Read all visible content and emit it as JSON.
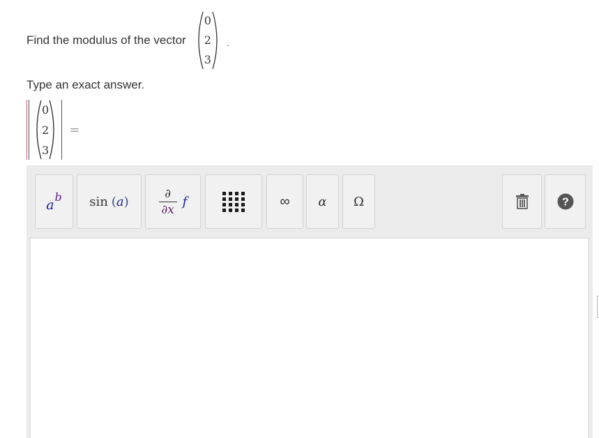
{
  "question": {
    "prefix": "Find the modulus of the vector",
    "vector": [
      "0",
      "2",
      "3"
    ],
    "suffix": "."
  },
  "instruction": "Type an exact answer.",
  "answer": {
    "vector": [
      "0",
      "2",
      "3"
    ],
    "equals": "="
  },
  "toolbar": {
    "power": {
      "base": "a",
      "exponent": "b"
    },
    "trig": {
      "func": "sin",
      "open": "(",
      "arg": "a",
      "close": ")"
    },
    "derivative": {
      "numerator": "∂",
      "denominator": "∂x",
      "func": "f"
    },
    "infinity": "∞",
    "greek": "α",
    "symbols": "Ω"
  },
  "colors": {
    "toolbar_bg": "#ebebeb",
    "button_bg": "#f1f1f1",
    "math_navy": "#1a1a9e",
    "math_purple": "#5a1a8a",
    "help_icon": "#555555"
  }
}
